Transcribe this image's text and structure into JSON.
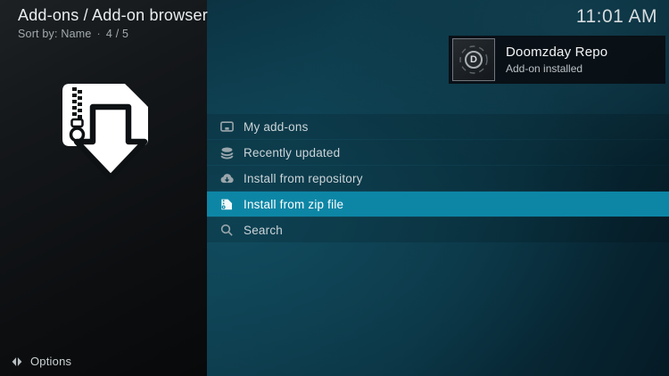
{
  "header": {
    "title": "Add-ons / Add-on browser",
    "sort_label": "Sort by: Name",
    "separator": "·",
    "position": "4 / 5"
  },
  "clock": "11:01 AM",
  "notification": {
    "title": "Doomzday Repo",
    "subtitle": "Add-on installed",
    "icon_letter": "D"
  },
  "menu": {
    "selected_index": 3,
    "items": [
      {
        "label": "My add-ons",
        "icon": "addons-box-icon"
      },
      {
        "label": "Recently updated",
        "icon": "recently-updated-icon"
      },
      {
        "label": "Install from repository",
        "icon": "cloud-download-icon"
      },
      {
        "label": "Install from zip file",
        "icon": "zip-file-icon"
      },
      {
        "label": "Search",
        "icon": "search-icon"
      }
    ]
  },
  "footer": {
    "options_label": "Options"
  },
  "colors": {
    "accent": "#0d86a6",
    "left_panel": "#101314",
    "background_teal": "#0c3949",
    "notification_bg": "rgba(9,13,18,0.92)",
    "text_primary": "#e9edef",
    "text_secondary": "#a2abaf"
  }
}
